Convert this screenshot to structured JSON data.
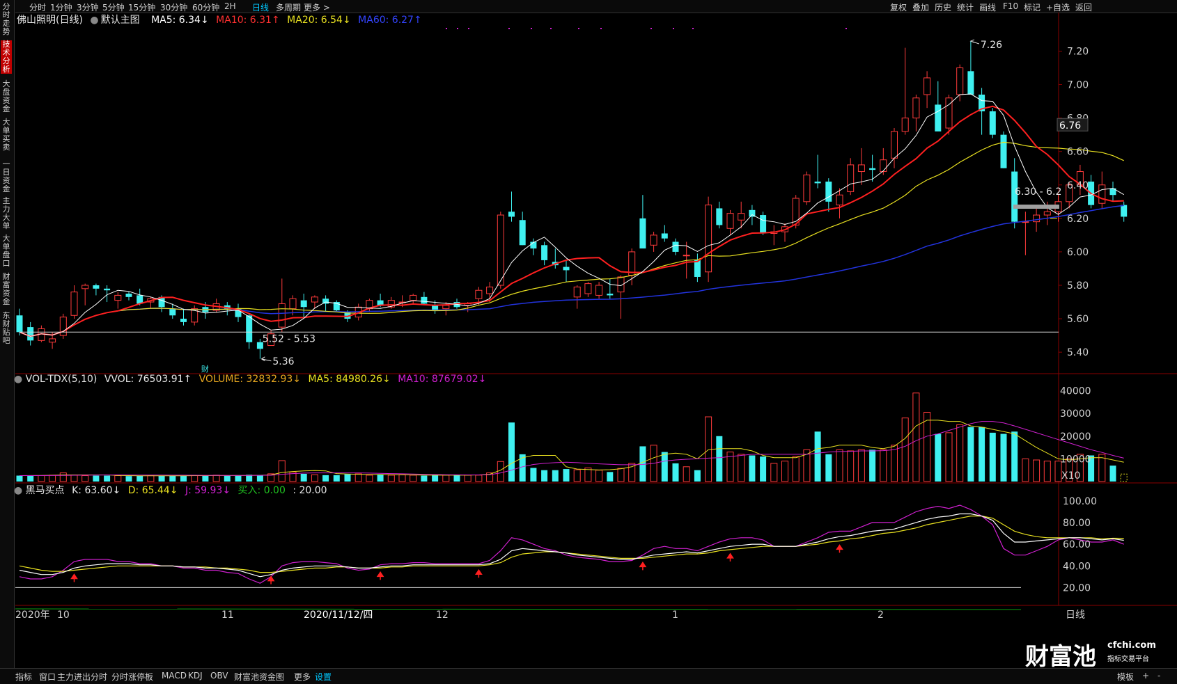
{
  "topbar": {
    "items": [
      "分时",
      "1分钟",
      "3分钟",
      "5分钟",
      "15分钟",
      "30分钟",
      "60分钟",
      "2H",
      "日线",
      "多周期",
      "更多 >"
    ],
    "active_index": 8,
    "right_items": [
      "复权",
      "叠加",
      "历史",
      "统计",
      "画线",
      "F10",
      "标记",
      "+自选",
      "返回"
    ]
  },
  "sidetabs": [
    "分时走势",
    "技术分析",
    "大盘资金",
    "大单买卖",
    "一日资金",
    "主力大单",
    "大单盘口",
    "财富资金",
    "东财贴吧"
  ],
  "sidetab_active": 1,
  "main_legend": {
    "title": "佛山照明(日线)",
    "template": "默认主图",
    "ma5": "MA5: 6.34↓",
    "ma10": "MA10: 6.31↑",
    "ma20": "MA20: 6.54↓",
    "ma60": "MA60: 6.27↑"
  },
  "vol_legend": {
    "name": "VOL-TDX(5,10)",
    "vvol": "VVOL: 76503.91↑",
    "volume": "VOLUME: 32832.93↓",
    "ma5": "MA5: 84980.26↓",
    "ma10": "MA10: 87679.02↓"
  },
  "kdj_legend": {
    "name": "黑马买点",
    "k": "K: 63.60↓",
    "d": "D: 65.44↓",
    "j": "J: 59.93↓",
    "buy": "买入: 0.00",
    "level": ": 20.00"
  },
  "annotations": {
    "high": "7.26",
    "low": "5.36",
    "range_low": "5.52 - 5.53",
    "range_high": "6.30 - 6.2",
    "current_price": "6.76",
    "cai": "财"
  },
  "bottom_axis": {
    "labels": [
      "2020年",
      "10",
      "11",
      "2020/11/12/四",
      "12",
      "1",
      "2"
    ],
    "right_label": "日线"
  },
  "bottombar": {
    "items": [
      "指标",
      "窗口",
      "主力进出分时",
      "分时涨停板",
      "MACD",
      "KDJ",
      "OBV",
      "财富池资金图",
      "更多",
      "设置"
    ],
    "active_index": 9,
    "right_items": [
      "模板",
      "+",
      "-"
    ]
  },
  "watermark": {
    "main": "财富池",
    "site": "cfchi.com",
    "tagline": "指标交易平台"
  },
  "colors": {
    "up": "#ff3b3b",
    "down": "#3ff0f0",
    "ma5": "#ffffff",
    "ma10": "#ff2020",
    "ma20": "#e8e020",
    "ma60": "#2233dd",
    "k": "#ffffff",
    "d": "#e8e020",
    "j": "#d020d0"
  },
  "chart_data": [
    {
      "type": "candlestick",
      "title": "佛山照明(日线)",
      "y_ticks": [
        5.4,
        5.6,
        5.8,
        6.0,
        6.2,
        6.4,
        6.6,
        6.8,
        7.0,
        7.2
      ],
      "ylim": [
        5.28,
        7.36
      ],
      "ohlc": [
        [
          5.62,
          5.66,
          5.5,
          5.52
        ],
        [
          5.55,
          5.58,
          5.44,
          5.47
        ],
        [
          5.47,
          5.56,
          5.46,
          5.54
        ],
        [
          5.46,
          5.52,
          5.42,
          5.48
        ],
        [
          5.5,
          5.63,
          5.48,
          5.61
        ],
        [
          5.62,
          5.8,
          5.6,
          5.76
        ],
        [
          5.78,
          5.81,
          5.68,
          5.8
        ],
        [
          5.8,
          5.81,
          5.74,
          5.78
        ],
        [
          5.78,
          5.8,
          5.7,
          5.77
        ],
        [
          5.71,
          5.76,
          5.66,
          5.74
        ],
        [
          5.75,
          5.76,
          5.71,
          5.73
        ],
        [
          5.74,
          5.78,
          5.68,
          5.69
        ],
        [
          5.7,
          5.73,
          5.66,
          5.72
        ],
        [
          5.73,
          5.74,
          5.64,
          5.67
        ],
        [
          5.66,
          5.69,
          5.6,
          5.62
        ],
        [
          5.6,
          5.66,
          5.56,
          5.58
        ],
        [
          5.58,
          5.68,
          5.56,
          5.66
        ],
        [
          5.67,
          5.7,
          5.6,
          5.64
        ],
        [
          5.65,
          5.72,
          5.64,
          5.69
        ],
        [
          5.68,
          5.7,
          5.62,
          5.66
        ],
        [
          5.66,
          5.69,
          5.58,
          5.61
        ],
        [
          5.62,
          5.63,
          5.42,
          5.46
        ],
        [
          5.46,
          5.48,
          5.36,
          5.42
        ],
        [
          5.44,
          5.53,
          5.44,
          5.51
        ],
        [
          5.55,
          5.84,
          5.52,
          5.69
        ],
        [
          5.66,
          5.74,
          5.62,
          5.72
        ],
        [
          5.71,
          5.75,
          5.6,
          5.67
        ],
        [
          5.7,
          5.74,
          5.66,
          5.73
        ],
        [
          5.72,
          5.74,
          5.64,
          5.69
        ],
        [
          5.7,
          5.71,
          5.64,
          5.65
        ],
        [
          5.64,
          5.65,
          5.58,
          5.6
        ],
        [
          5.61,
          5.69,
          5.59,
          5.67
        ],
        [
          5.66,
          5.72,
          5.64,
          5.71
        ],
        [
          5.71,
          5.75,
          5.67,
          5.68
        ],
        [
          5.67,
          5.73,
          5.66,
          5.71
        ],
        [
          5.7,
          5.74,
          5.67,
          5.7
        ],
        [
          5.71,
          5.75,
          5.69,
          5.74
        ],
        [
          5.73,
          5.76,
          5.68,
          5.69
        ],
        [
          5.68,
          5.71,
          5.63,
          5.65
        ],
        [
          5.66,
          5.7,
          5.62,
          5.68
        ],
        [
          5.7,
          5.72,
          5.66,
          5.67
        ],
        [
          5.68,
          5.7,
          5.64,
          5.69
        ],
        [
          5.72,
          5.79,
          5.68,
          5.77
        ],
        [
          5.75,
          5.82,
          5.7,
          5.79
        ],
        [
          5.8,
          6.24,
          5.78,
          6.22
        ],
        [
          6.24,
          6.36,
          6.18,
          6.21
        ],
        [
          6.19,
          6.24,
          6.04,
          6.04
        ],
        [
          6.06,
          6.08,
          5.98,
          6.02
        ],
        [
          6.04,
          6.06,
          5.92,
          5.95
        ],
        [
          5.94,
          6.02,
          5.9,
          5.92
        ],
        [
          5.91,
          5.95,
          5.82,
          5.89
        ],
        [
          5.73,
          5.8,
          5.66,
          5.79
        ],
        [
          5.75,
          5.82,
          5.73,
          5.81
        ],
        [
          5.74,
          5.82,
          5.72,
          5.8
        ],
        [
          5.75,
          5.84,
          5.72,
          5.74
        ],
        [
          5.76,
          5.86,
          5.6,
          5.85
        ],
        [
          5.86,
          6.02,
          5.8,
          6.0
        ],
        [
          6.2,
          6.34,
          6.14,
          6.02
        ],
        [
          6.04,
          6.12,
          6.0,
          6.1
        ],
        [
          6.11,
          6.16,
          6.06,
          6.08
        ],
        [
          6.06,
          6.08,
          5.98,
          6.0
        ],
        [
          5.98,
          6.06,
          5.84,
          5.98
        ],
        [
          5.95,
          5.99,
          5.82,
          5.85
        ],
        [
          5.88,
          6.33,
          5.82,
          6.28
        ],
        [
          6.26,
          6.3,
          6.14,
          6.16
        ],
        [
          6.14,
          6.25,
          6.1,
          6.23
        ],
        [
          6.19,
          6.3,
          6.14,
          6.23
        ],
        [
          6.25,
          6.28,
          6.16,
          6.21
        ],
        [
          6.22,
          6.24,
          6.1,
          6.11
        ],
        [
          6.11,
          6.16,
          6.04,
          6.12
        ],
        [
          6.12,
          6.17,
          6.06,
          6.15
        ],
        [
          6.16,
          6.34,
          6.14,
          6.32
        ],
        [
          6.3,
          6.48,
          6.28,
          6.46
        ],
        [
          6.42,
          6.58,
          6.38,
          6.41
        ],
        [
          6.42,
          6.44,
          6.24,
          6.3
        ],
        [
          6.28,
          6.38,
          6.2,
          6.34
        ],
        [
          6.36,
          6.56,
          6.34,
          6.52
        ],
        [
          6.48,
          6.62,
          6.4,
          6.52
        ],
        [
          6.5,
          6.58,
          6.42,
          6.49
        ],
        [
          6.48,
          6.62,
          6.46,
          6.55
        ],
        [
          6.56,
          6.74,
          6.5,
          6.72
        ],
        [
          6.72,
          7.22,
          6.7,
          6.8
        ],
        [
          6.8,
          6.94,
          6.72,
          6.92
        ],
        [
          6.94,
          7.08,
          6.86,
          7.04
        ],
        [
          6.88,
          7.02,
          6.84,
          6.72
        ],
        [
          6.74,
          6.94,
          6.7,
          6.92
        ],
        [
          6.94,
          7.12,
          6.9,
          7.1
        ],
        [
          7.08,
          7.26,
          7.0,
          6.94
        ],
        [
          6.94,
          6.98,
          6.7,
          6.84
        ],
        [
          6.84,
          6.86,
          6.68,
          6.7
        ],
        [
          6.7,
          6.72,
          6.5,
          6.5
        ],
        [
          6.48,
          6.56,
          6.14,
          6.18
        ],
        [
          6.18,
          6.24,
          5.98,
          6.18
        ],
        [
          6.18,
          6.26,
          6.12,
          6.22
        ],
        [
          6.22,
          6.3,
          6.16,
          6.24
        ],
        [
          6.24,
          6.34,
          6.18,
          6.3
        ],
        [
          6.3,
          6.42,
          6.26,
          6.4
        ],
        [
          6.4,
          6.52,
          6.34,
          6.48
        ],
        [
          6.42,
          6.46,
          6.26,
          6.28
        ],
        [
          6.29,
          6.48,
          6.26,
          6.4
        ],
        [
          6.38,
          6.42,
          6.3,
          6.34
        ],
        [
          6.28,
          6.3,
          6.18,
          6.21
        ]
      ]
    },
    {
      "type": "bar",
      "title": "VOL-TDX(5,10)",
      "y_ticks": [
        10000,
        20000,
        30000,
        40000
      ],
      "y_unit": "X10",
      "ylim": [
        0,
        42000
      ],
      "volume": [
        2600,
        2600,
        2600,
        2800,
        3800,
        2800,
        2600,
        2600,
        2600,
        2600,
        2400,
        2600,
        2600,
        2600,
        2600,
        2600,
        2600,
        2600,
        2800,
        2600,
        2800,
        3000,
        2800,
        3400,
        9200,
        4200,
        3400,
        3000,
        2800,
        2800,
        3200,
        3400,
        2800,
        3000,
        2800,
        3000,
        2800,
        2600,
        2800,
        2800,
        2800,
        2800,
        2800,
        3800,
        8800,
        26000,
        12000,
        6000,
        5000,
        5000,
        5500,
        5200,
        6000,
        5000,
        4200,
        5800,
        8000,
        15500,
        16000,
        13000,
        8000,
        6500,
        5000,
        28500,
        20000,
        13000,
        12000,
        11500,
        11000,
        8000,
        9000,
        11000,
        14000,
        22000,
        12000,
        14000,
        13500,
        14000,
        14000,
        14000,
        16000,
        28000,
        39000,
        30500,
        21000,
        21500,
        25000,
        24000,
        24000,
        21500,
        21000,
        22000,
        10000,
        9500,
        9000,
        9000,
        10000,
        12000,
        11500,
        12000,
        7000,
        3280
      ],
      "ma5": [
        2600,
        2650,
        2700,
        2750,
        2900,
        2900,
        2900,
        2900,
        2900,
        2700,
        2600,
        2550,
        2550,
        2550,
        2550,
        2550,
        2600,
        2600,
        2650,
        2650,
        2650,
        2700,
        2750,
        2900,
        4000,
        4400,
        4700,
        4800,
        4700,
        3500,
        3300,
        3200,
        3100,
        3100,
        3000,
        2950,
        2900,
        2850,
        2800,
        2800,
        2800,
        2800,
        2900,
        3200,
        5000,
        8000,
        10500,
        11500,
        11500,
        11500,
        6500,
        5500,
        5300,
        5100,
        5200,
        5600,
        6500,
        8500,
        10500,
        12000,
        12500,
        12000,
        10000,
        14000,
        14500,
        14500,
        14500,
        13500,
        11500,
        10500,
        10500,
        10500,
        12000,
        14500,
        15000,
        16000,
        16000,
        16000,
        15000,
        14500,
        15500,
        19000,
        24500,
        27000,
        27000,
        26500,
        26500,
        24500,
        24000,
        23000,
        22000,
        21000,
        18000,
        15000,
        12500,
        10000,
        9500,
        10000,
        10500,
        10500,
        9500,
        8500
      ],
      "ma10": [
        2600,
        2600,
        2620,
        2650,
        2700,
        2750,
        2800,
        2850,
        2880,
        2900,
        2880,
        2860,
        2840,
        2820,
        2800,
        2780,
        2760,
        2740,
        2720,
        2700,
        2700,
        2700,
        2720,
        2750,
        3200,
        3500,
        3700,
        3800,
        3800,
        3800,
        3800,
        3800,
        3700,
        3600,
        3500,
        3400,
        3300,
        3200,
        3100,
        3000,
        2950,
        2900,
        2900,
        3000,
        3800,
        5000,
        6500,
        7500,
        8000,
        8300,
        8500,
        8300,
        8000,
        7800,
        7600,
        7400,
        7400,
        7500,
        8000,
        9000,
        9500,
        9800,
        10000,
        10300,
        10500,
        11000,
        11500,
        12000,
        12000,
        12000,
        12000,
        12000,
        12000,
        12500,
        13000,
        13200,
        13300,
        13500,
        13500,
        13600,
        14000,
        15500,
        18000,
        20000,
        21000,
        22500,
        24000,
        25500,
        26500,
        26500,
        25800,
        24500,
        23000,
        21500,
        20000,
        18500,
        17000,
        15500,
        14000,
        12800,
        11500,
        10300
      ]
    },
    {
      "type": "line",
      "title": "黑马买点",
      "y_ticks": [
        20.0,
        40.0,
        60.0,
        80.0,
        100.0
      ],
      "ylim": [
        10,
        105
      ],
      "k": [
        36,
        34,
        32,
        32,
        34,
        38,
        40,
        41,
        42,
        42,
        42,
        41,
        41,
        40,
        40,
        39,
        39,
        38,
        38,
        37,
        36,
        33,
        30,
        32,
        36,
        38,
        39,
        40,
        40,
        40,
        39,
        38,
        38,
        39,
        40,
        40,
        41,
        41,
        41,
        41,
        41,
        41,
        41,
        42,
        46,
        54,
        56,
        55,
        54,
        53,
        52,
        50,
        49,
        48,
        47,
        46,
        46,
        48,
        50,
        51,
        52,
        53,
        52,
        54,
        56,
        58,
        59,
        60,
        60,
        58,
        58,
        58,
        60,
        62,
        65,
        67,
        68,
        70,
        72,
        73,
        74,
        77,
        80,
        83,
        85,
        86,
        88,
        88,
        86,
        82,
        70,
        62,
        62,
        63,
        64,
        65,
        66,
        66,
        65,
        64,
        65,
        63.6
      ],
      "d": [
        40,
        38,
        36,
        35,
        35,
        36,
        37,
        38,
        39,
        40,
        40,
        40,
        40,
        40,
        40,
        39,
        39,
        39,
        38,
        38,
        37,
        36,
        34,
        34,
        35,
        36,
        37,
        38,
        38,
        39,
        39,
        38,
        38,
        38,
        39,
        39,
        40,
        40,
        40,
        40,
        40,
        40,
        40,
        41,
        43,
        48,
        51,
        52,
        53,
        53,
        52,
        51,
        50,
        49,
        48,
        47,
        47,
        47,
        48,
        49,
        50,
        51,
        51,
        52,
        54,
        55,
        56,
        57,
        58,
        58,
        58,
        58,
        59,
        60,
        62,
        63,
        65,
        66,
        68,
        70,
        71,
        73,
        75,
        78,
        80,
        82,
        84,
        86,
        86,
        84,
        78,
        72,
        69,
        67,
        66,
        66,
        66,
        66,
        66,
        65,
        65.5,
        65.44
      ],
      "j": [
        30,
        28,
        28,
        30,
        36,
        44,
        46,
        46,
        46,
        44,
        44,
        42,
        42,
        40,
        40,
        38,
        38,
        36,
        36,
        34,
        33,
        28,
        24,
        30,
        40,
        43,
        44,
        44,
        43,
        42,
        38,
        36,
        37,
        41,
        42,
        42,
        43,
        43,
        42,
        42,
        42,
        42,
        42,
        45,
        54,
        66,
        64,
        60,
        56,
        54,
        50,
        48,
        47,
        46,
        44,
        44,
        45,
        50,
        56,
        58,
        56,
        56,
        54,
        58,
        62,
        65,
        66,
        66,
        64,
        58,
        58,
        58,
        62,
        66,
        71,
        72,
        72,
        76,
        80,
        80,
        80,
        85,
        90,
        93,
        95,
        93,
        96,
        92,
        86,
        78,
        56,
        50,
        50,
        54,
        58,
        64,
        66,
        64,
        62,
        62,
        64,
        59.93
      ],
      "buy_signals_at": [
        5,
        23,
        33,
        42,
        57,
        65,
        75
      ]
    }
  ]
}
